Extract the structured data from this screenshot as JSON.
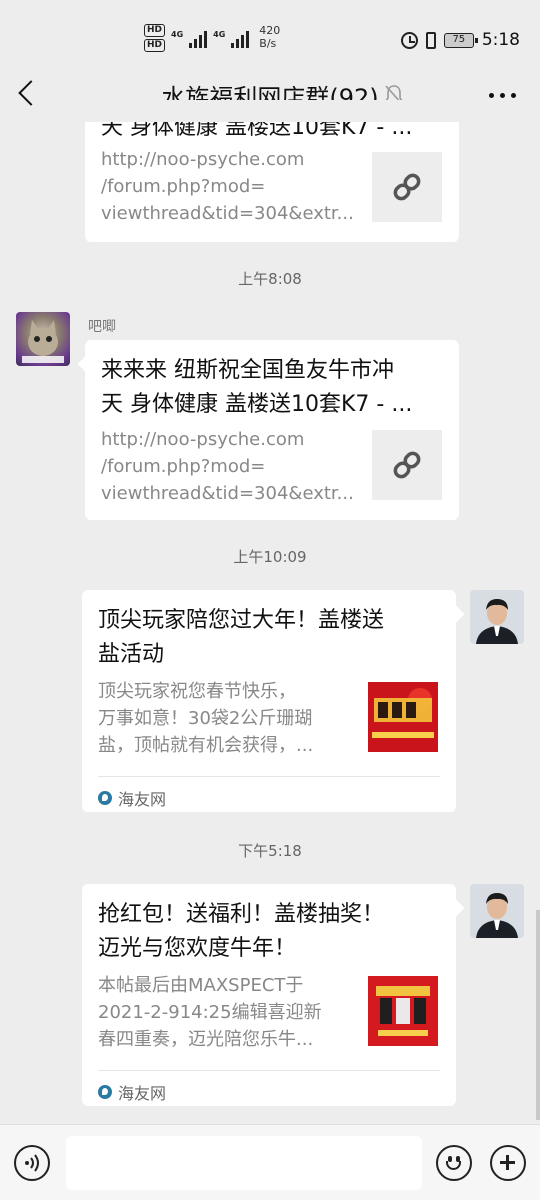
{
  "status_bar": {
    "hd1": "HD",
    "hd2": "HD",
    "net1": "4G",
    "net2": "4G",
    "speed_value": "420",
    "speed_unit": "B/s",
    "battery": "75",
    "time": "5:18"
  },
  "nav": {
    "title": "水族福利网店群(92)"
  },
  "messages": [
    {
      "title_partial": "天 身体健康 盖楼送10套K7 - ...",
      "desc": [
        "http://noo-psyche.com",
        "/forum.php?mod=",
        "viewthread&tid=304&extr..."
      ]
    },
    {
      "time": "上午8:08",
      "sender": "吧唧",
      "title": [
        "来来来 纽斯祝全国鱼友牛市冲",
        "天 身体健康 盖楼送10套K7 - ..."
      ],
      "desc": [
        "http://noo-psyche.com",
        "/forum.php?mod=",
        "viewthread&tid=304&extr..."
      ]
    },
    {
      "time": "上午10:09",
      "title": [
        "顶尖玩家陪您过大年！盖楼送",
        "盐活动"
      ],
      "desc": [
        "顶尖玩家祝您春节快乐，",
        "万事如意！30袋2公斤珊瑚",
        "盐，顶帖就有机会获得，..."
      ],
      "source": "海友网"
    },
    {
      "time": "下午5:18",
      "title": [
        "抢红包！送福利！盖楼抽奖！",
        "迈光与您欢度牛年！"
      ],
      "desc": [
        "本帖最后由MAXSPECT于",
        "2021-2-914:25编辑喜迎新",
        "春四重奏，迈光陪您乐牛..."
      ],
      "source": "海友网"
    }
  ],
  "colors": {
    "background": "#ededed",
    "bubble": "#ffffff",
    "muted_text": "#888888"
  }
}
